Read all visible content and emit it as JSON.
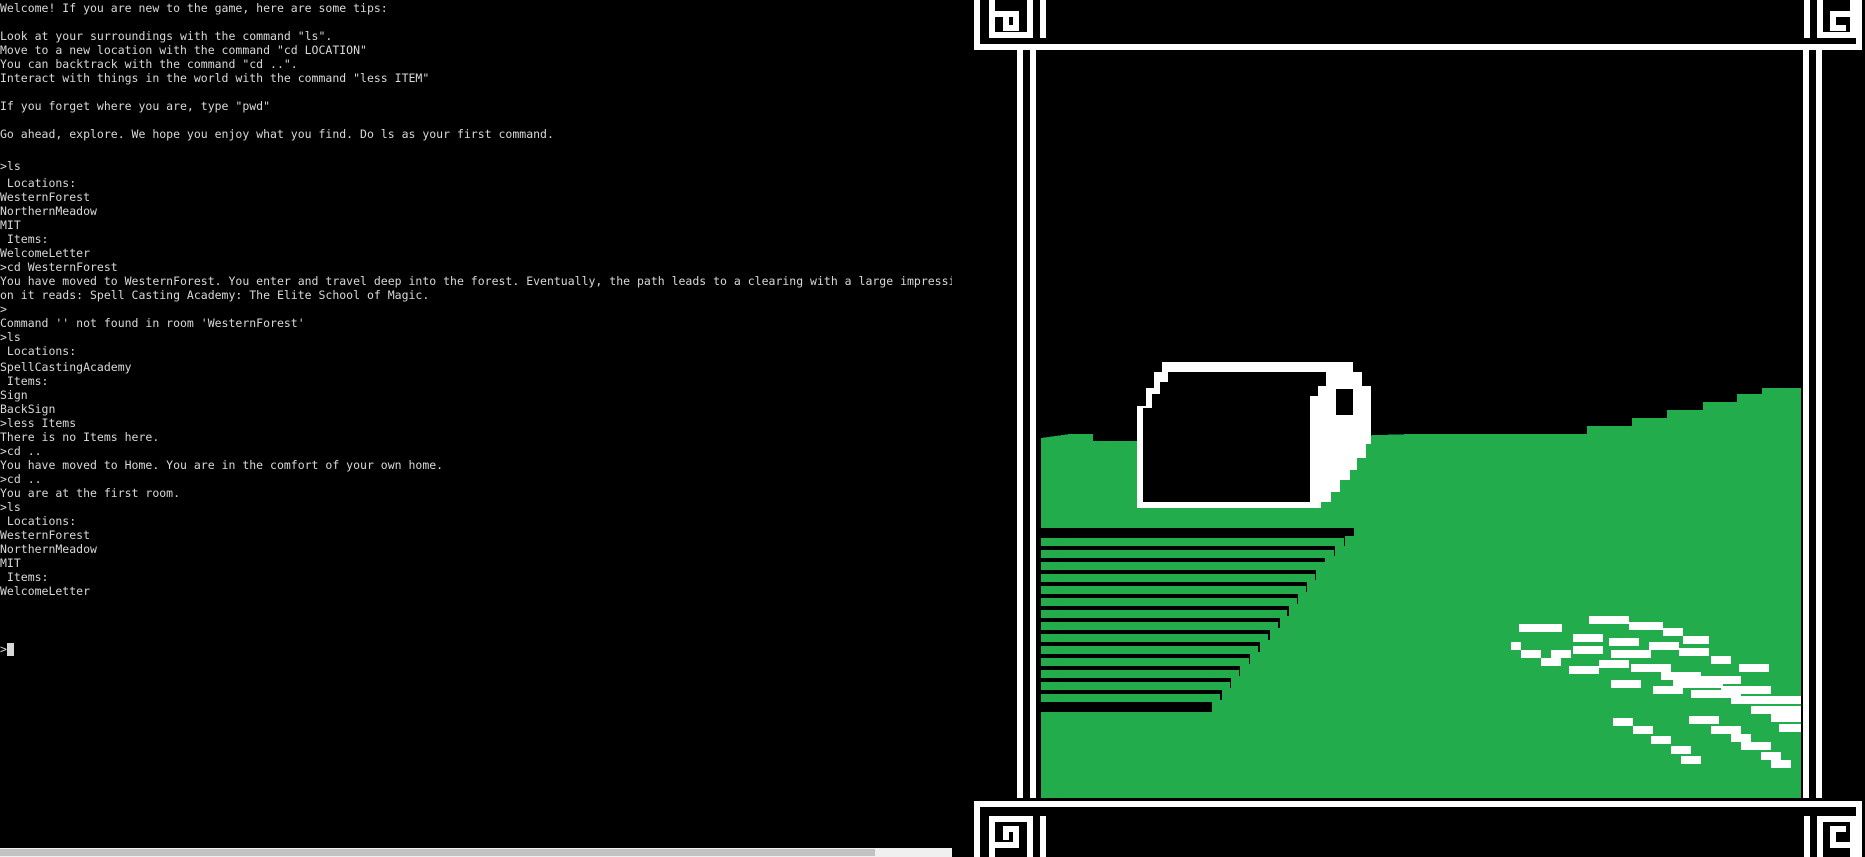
{
  "terminal": {
    "lines": [
      "Welcome! If you are new to the game, here are some tips:",
      "",
      "Look at your surroundings with the command \"ls\".",
      "Move to a new location with the command \"cd LOCATION\"",
      "You can backtrack with the command \"cd ..\".",
      "Interact with things in the world with the command \"less ITEM\"",
      "",
      "If you forget where you are, type \"pwd\"",
      "",
      "Go ahead, explore. We hope you enjoy what you find. Do ls as your first command.",
      "",
      ">ls",
      " Locations:",
      "WesternForest",
      "NorthernMeadow",
      "MIT",
      " Items:",
      "WelcomeLetter",
      ">cd WesternForest",
      "You have moved to WesternForest. You enter and travel deep into the forest. Eventually, the path leads to a clearing with a large impressive bui",
      "on it reads: Spell Casting Academy: The Elite School of Magic.",
      ">",
      "Command '' not found in room 'WesternForest'",
      ">ls",
      " Locations:",
      "SpellCastingAcademy",
      " Items:",
      "Sign",
      "BackSign",
      ">less Items",
      "There is no Items here.",
      ">cd ..",
      "You have moved to Home. You are in the comfort of your own home.",
      ">cd ..",
      "You are at the first room.",
      ">ls",
      " Locations:",
      "WesternForest",
      "NorthernMeadow",
      "MIT",
      " Items:",
      "WelcomeLetter"
    ],
    "prompt": ">"
  },
  "colors": {
    "background": "#000000",
    "text": "#d8d8d8",
    "grass": "#22ac4b",
    "frame": "#ffffff"
  },
  "art": {
    "icon": "pixel-art-forest-clearing-scene"
  }
}
